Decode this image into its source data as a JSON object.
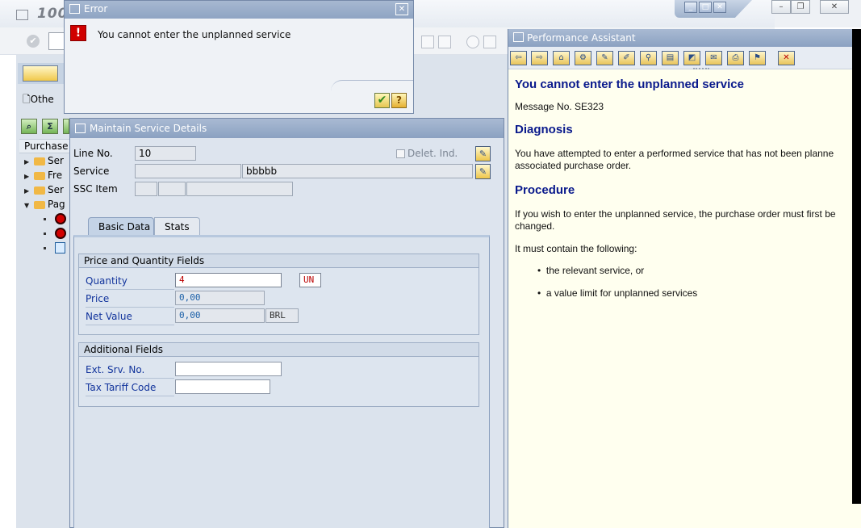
{
  "background_window": {
    "title": "100",
    "other_button": "Othe",
    "tree_header": "Purchase O",
    "tree_nodes": [
      "Ser",
      "Fre",
      "Ser",
      "Pag"
    ]
  },
  "error_dialog": {
    "title": "Error",
    "message": "You cannot enter the unplanned service",
    "ok_icon": "check-icon",
    "help_icon": "question-icon"
  },
  "service_details": {
    "title": "Maintain Service Details",
    "line_no_label": "Line No.",
    "line_no_value": "10",
    "delet_ind_label": "Delet. Ind.",
    "service_label": "Service",
    "service_code": "",
    "service_text": "bbbbb",
    "ssc_item_label": "SSC Item",
    "tabs": [
      {
        "label": "Basic Data",
        "active": true
      },
      {
        "label": "Stats",
        "active": false
      }
    ],
    "price_group": {
      "title": "Price and Quantity Fields",
      "quantity_label": "Quantity",
      "quantity_value": "4",
      "unit_value": "UN",
      "price_label": "Price",
      "price_value": "0,00",
      "net_value_label": "Net Value",
      "net_value_value": "0,00",
      "currency_value": "BRL"
    },
    "additional_group": {
      "title": "Additional Fields",
      "ext_srv_label": "Ext. Srv. No.",
      "ext_srv_value": "",
      "tax_tariff_label": "Tax Tariff Code",
      "tax_tariff_value": ""
    }
  },
  "performance_assistant": {
    "title": "Performance Assistant",
    "heading": "You cannot enter the unplanned service",
    "message_no": "Message No. SE323",
    "diagnosis_heading": "Diagnosis",
    "diagnosis_line1": "You have attempted to enter a performed service that has not been planne",
    "diagnosis_line2": "associated purchase order.",
    "procedure_heading": "Procedure",
    "procedure_line1": "If you wish to enter the unplanned service, the purchase order must first be",
    "procedure_line2": "changed.",
    "procedure_line3": "It must contain the following:",
    "bullets": [
      "the relevant service, or",
      "a value limit for unplanned services"
    ]
  },
  "colors": {
    "title_bar": "#8ea4c3",
    "error_red": "#d00000",
    "help_heading": "#0a1a8c",
    "help_background": "#ffffef"
  }
}
